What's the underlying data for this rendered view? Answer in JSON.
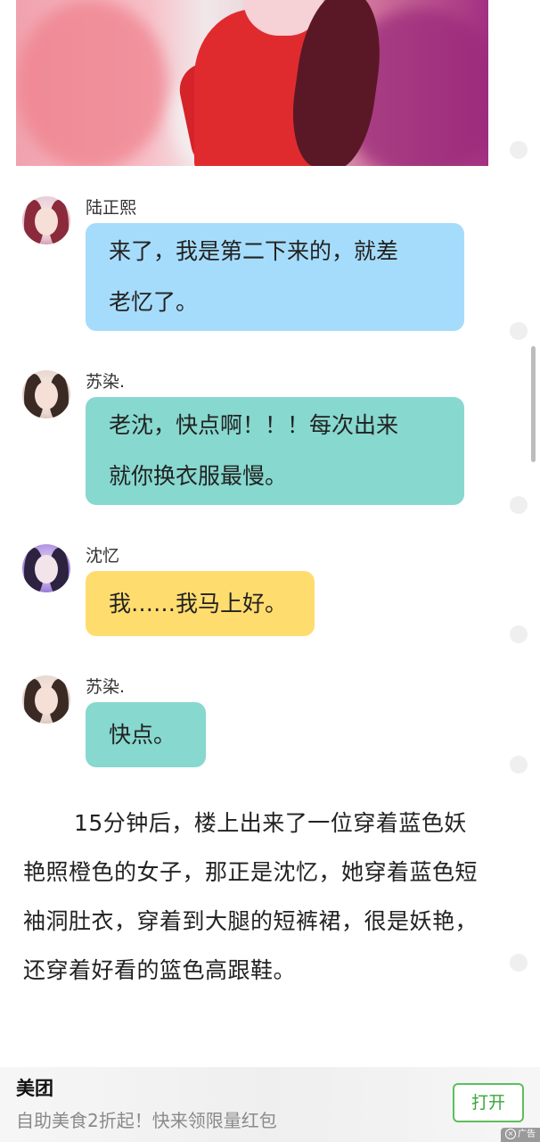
{
  "colors": {
    "bubble_blue": "#a6dcfb",
    "bubble_teal": "#87d8cf",
    "bubble_yellow": "#ffdc6e",
    "ad_button_border": "#5cbf5a"
  },
  "messages": [
    {
      "sender": "陆正熙",
      "text_lines": [
        "来了，我是第二下来的，就差",
        "老忆了。"
      ],
      "bubble_color": "#a6dcfb",
      "avatar_icon": "girl-red-hair-avatar"
    },
    {
      "sender": "苏染.",
      "text_lines": [
        "老沈，快点啊！！！每次出来",
        "就你换衣服最慢。"
      ],
      "bubble_color": "#87d8cf",
      "avatar_icon": "girl-dark-hair-avatar"
    },
    {
      "sender": "沈忆",
      "text_lines": [
        "我……我马上好。"
      ],
      "bubble_color": "#ffdc6e",
      "avatar_icon": "girl-purple-avatar"
    },
    {
      "sender": "苏染.",
      "text_lines": [
        "快点。"
      ],
      "bubble_color": "#87d8cf",
      "avatar_icon": "girl-dark-hair-avatar"
    }
  ],
  "narrative": "15分钟后，楼上出来了一位穿着蓝色妖艳照橙色的女子，那正是沈忆，她穿着蓝色短袖洞肚衣，穿着到大腿的短裤裙，很是妖艳，还穿着好看的篮色高跟鞋。",
  "ad": {
    "brand": "美团",
    "text": "自助美食2折起！快来领限量红包",
    "button_label": "打开",
    "tag_label": "广告"
  }
}
